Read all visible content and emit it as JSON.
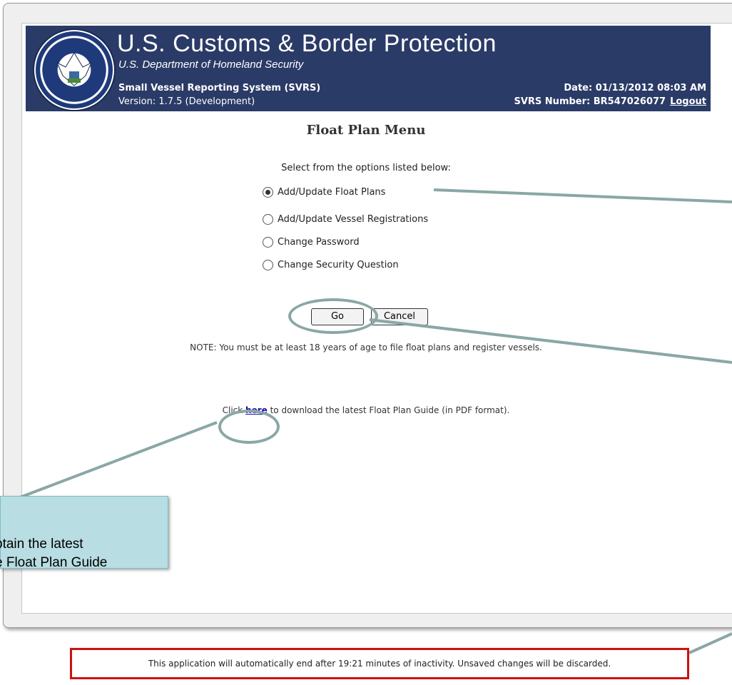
{
  "header": {
    "agency": "U.S. Customs & Border Protection",
    "department": "U.S. Department of Homeland Security",
    "system_name": "Small Vessel Reporting System (SVRS)",
    "version": "Version: 1.7.5 (Development)",
    "date": "Date: 01/13/2012 08:03 AM",
    "svrs_number": "SVRS Number: BR547026077",
    "logout_label": "Logout",
    "seal_text": "DEPARTMENT OF HOMELAND SECURITY"
  },
  "main": {
    "title": "Float Plan Menu",
    "instructions": "Select from the options listed below:",
    "options": [
      {
        "label": "Add/Update Float Plans",
        "selected": true
      },
      {
        "label": "Add/Update Vessel Registrations",
        "selected": false
      },
      {
        "label": "Change Password",
        "selected": false
      },
      {
        "label": "Change Security Question",
        "selected": false
      }
    ],
    "go_label": "Go",
    "cancel_label": "Cancel",
    "note": "NOTE: You must be at least 18 years of age to file float plans and register vessels.",
    "download_prefix": "Click ",
    "download_link": "here",
    "download_suffix": " to download the latest Float Plan Guide (in PDF format)."
  },
  "callout": {
    "line1": "btain the latest",
    "line2": "e Float Plan Guide"
  },
  "footer": {
    "timeout_text": "This application will automatically end after 19:21 minutes of inactivity. Unsaved changes will be discarded."
  },
  "colors": {
    "banner": "#2b3b67",
    "callout_fill": "#b8dde2",
    "callout_line": "#8aa7a5",
    "timeout_border": "#cc1111"
  }
}
